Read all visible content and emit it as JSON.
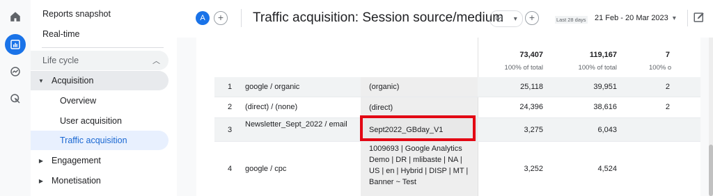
{
  "nav": {
    "reports_snapshot": "Reports snapshot",
    "realtime": "Real-time",
    "life_cycle": "Life cycle",
    "acquisition": "Acquisition",
    "overview": "Overview",
    "user_acquisition": "User acquisition",
    "traffic_acquisition": "Traffic acquisition",
    "engagement": "Engagement",
    "monetisation": "Monetisation"
  },
  "header": {
    "avatar_letter": "A",
    "title": "Traffic acquisition: Session source/medium",
    "date_label": "Last 28 days",
    "date_range": "21 Feb - 20 Mar 2023",
    "dropdown_arrow": "▾"
  },
  "table": {
    "totals": [
      {
        "value": "73,407",
        "pct": "100% of total"
      },
      {
        "value": "119,167",
        "pct": "100% of total"
      },
      {
        "value": "7",
        "pct": "100% o"
      }
    ],
    "rows": [
      {
        "index": "1",
        "source": "google / organic",
        "dim2": "(organic)",
        "v1": "25,118",
        "v2": "39,951",
        "v3": "2"
      },
      {
        "index": "2",
        "source": "(direct) / (none)",
        "dim2": "(direct)",
        "v1": "24,396",
        "v2": "38,616",
        "v3": "2"
      },
      {
        "index": "3",
        "source": "Newsletter_Sept_2022 / email",
        "dim2": "Sept2022_GBday_V1",
        "v1": "3,275",
        "v2": "6,043",
        "v3": ""
      },
      {
        "index": "4",
        "source": "google / cpc",
        "dim2": "1009693 | Google Analytics Demo | DR | mlibaste | NA | US | en | Hybrid | DISP | MT | Banner ~ Test",
        "v1": "3,252",
        "v2": "4,524",
        "v3": ""
      }
    ]
  },
  "colors": {
    "accent": "#1a73e8",
    "highlight": "#e30613",
    "selected_nav_bg": "#e8f0fe"
  }
}
